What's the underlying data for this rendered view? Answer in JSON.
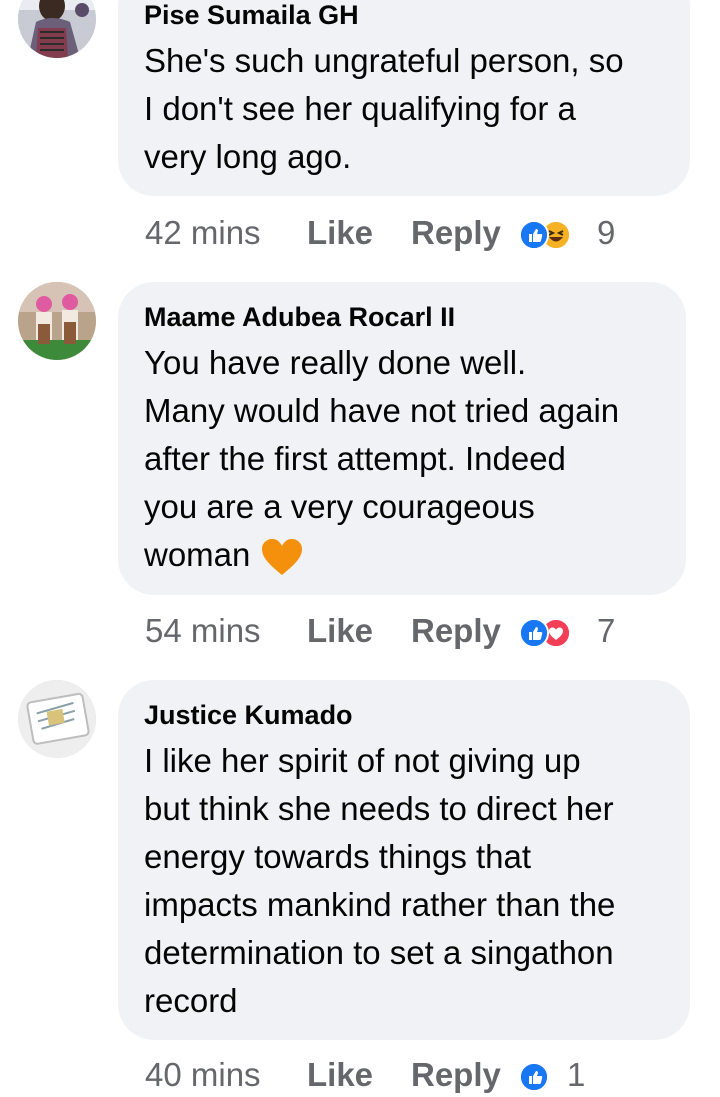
{
  "comments": [
    {
      "author": "Pise Sumaila GH",
      "text_lines": [
        "She's such ungrateful person, so",
        "I don't see her qualifying for a",
        "very long ago."
      ],
      "time": "42 mins",
      "like_label": "Like",
      "reply_label": "Reply",
      "reactions": [
        "like-icon",
        "haha-icon"
      ],
      "reaction_count": "9"
    },
    {
      "author": "Maame Adubea Rocarl II",
      "text_lines": [
        "You have really done well.",
        "Many would have not tried again",
        "after the first attempt. Indeed",
        "you are a very courageous",
        "woman"
      ],
      "trailing_emoji": "orange-heart-icon",
      "time": "54 mins",
      "like_label": "Like",
      "reply_label": "Reply",
      "reactions": [
        "like-icon",
        "love-icon"
      ],
      "reaction_count": "7"
    },
    {
      "author": "Justice Kumado",
      "text_lines": [
        "I like her spirit of not giving up",
        "but think she needs to direct her",
        "energy towards things that",
        "impacts mankind rather than the",
        "determination to set a singathon",
        "record"
      ],
      "time": "40 mins",
      "like_label": "Like",
      "reply_label": "Reply",
      "reactions": [
        "like-icon"
      ],
      "reaction_count": "1"
    }
  ],
  "colors": {
    "bubble": "#f0f2f5",
    "text": "#050505",
    "meta": "#65676b",
    "like_blue": "#1877f2",
    "love_red": "#f33e58",
    "haha_yellow": "#f7b125",
    "orange_heart": "#f4900c"
  }
}
